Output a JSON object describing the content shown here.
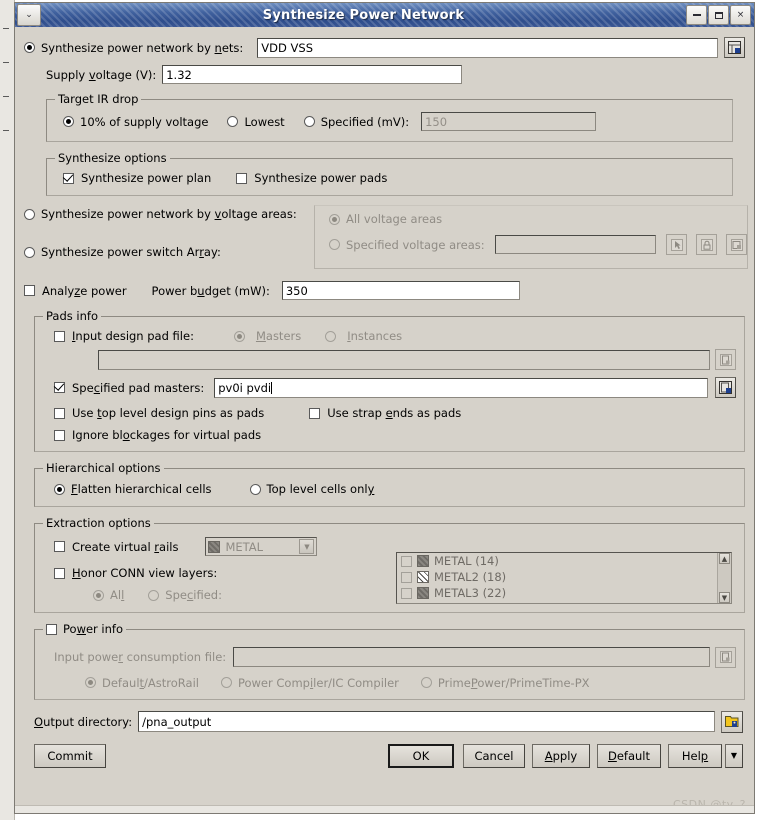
{
  "window": {
    "title": "Synthesize Power Network",
    "sysmenu_icon": "chevron-down-icon",
    "minimize_label": "–",
    "maximize_label": "□",
    "close_label": "×"
  },
  "nets_section": {
    "radio_label": "Synthesize power network by nets:",
    "nets_value": "VDD VSS",
    "browse_icon": "browse-icon",
    "supply_voltage_label": "Supply voltage (V):",
    "supply_voltage_value": "1.32"
  },
  "target_ir_drop": {
    "legend": "Target IR drop",
    "option_percent": "10% of supply voltage",
    "option_lowest": "Lowest",
    "option_specified": "Specified (mV):",
    "specified_value": "150"
  },
  "synthesize_options": {
    "legend": "Synthesize options",
    "power_plan": "Synthesize power plan",
    "power_pads": "Synthesize power pads"
  },
  "voltage_areas": {
    "by_voltage_areas_label": "Synthesize power network by voltage areas:",
    "power_switch_array_label": "Synthesize power switch Array:",
    "all_voltage_areas": "All voltage areas",
    "specified_voltage_areas": "Specified voltage areas:",
    "specified_value": "",
    "pick_icon": "cursor-pick-icon",
    "lock_icon": "lock-icon",
    "browse_icon": "browse-icon"
  },
  "analyze": {
    "analyze_power_label": "Analyze power",
    "power_budget_label": "Power budget (mW):",
    "power_budget_value": "350"
  },
  "pads_info": {
    "legend": "Pads info",
    "input_design_pad_file": "Input design pad file:",
    "masters": "Masters",
    "instances": "Instances",
    "pad_file_value": "",
    "pad_file_browse_icon": "browse-icon",
    "specified_pad_masters": "Specified pad masters:",
    "specified_pad_masters_value": "pv0i pvdi",
    "specified_browse_icon": "browse-icon",
    "use_top_level_design_pins": "Use top level design pins as pads",
    "use_strap_ends": "Use strap ends as pads",
    "ignore_blockages": "Ignore blockages for virtual pads"
  },
  "hierarchical_options": {
    "legend": "Hierarchical options",
    "flatten": "Flatten hierarchical cells",
    "top_level_only": "Top level cells only"
  },
  "extraction_options": {
    "legend": "Extraction options",
    "create_virtual_rails": "Create virtual rails",
    "virtual_rails_layer": "METAL",
    "honor_conn_view_layers": "Honor CONN view layers:",
    "all": "All",
    "specified": "Specified:",
    "layers": [
      {
        "name": "METAL (14)",
        "swatch": "hatch-dark",
        "checked": false
      },
      {
        "name": "METAL2 (18)",
        "swatch": "hatch-light",
        "checked": false
      },
      {
        "name": "METAL3 (22)",
        "swatch": "hatch-dark",
        "checked": false
      }
    ]
  },
  "power_info": {
    "legend": "Power info",
    "input_power_consumption_file": "Input power consumption file:",
    "file_value": "",
    "browse_icon": "browse-icon",
    "default_astrorail": "Default/AstroRail",
    "power_compiler": "Power Compiler/IC Compiler",
    "primepower": "PrimePower/PrimeTime-PX"
  },
  "footer": {
    "output_directory_label": "Output directory:",
    "output_directory_value": "/pna_output",
    "folder_icon": "folder-browse-icon",
    "commit": "Commit",
    "ok": "OK",
    "cancel": "Cancel",
    "apply": "Apply",
    "default": "Default",
    "help": "Help",
    "more_arrow": "▼"
  },
  "watermark": "CSDN @ty_?",
  "colors": {
    "title_bar": "#2e4d8c",
    "dialog_bg": "#d6d2ca",
    "field_bg": "#ffffff",
    "disabled_text": "#908c85"
  }
}
